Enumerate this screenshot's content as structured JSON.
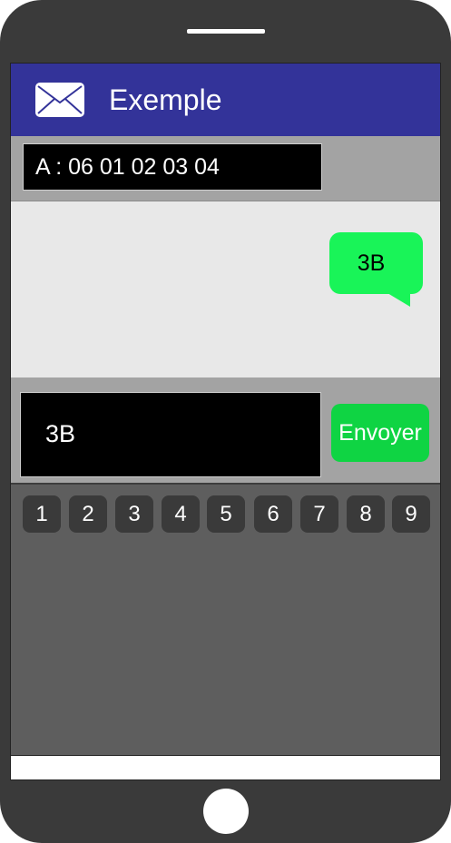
{
  "header": {
    "title": "Exemple",
    "icon": "envelope-icon"
  },
  "recipient": {
    "value": "A : 06 01 02 03 04"
  },
  "conversation": {
    "messages": [
      {
        "text": "3B"
      }
    ]
  },
  "compose": {
    "value": "3B",
    "send_label": "Envoyer"
  },
  "keypad": {
    "keys": [
      "1",
      "2",
      "3",
      "4",
      "5",
      "6",
      "7",
      "8",
      "9"
    ]
  },
  "colors": {
    "header": "#333399",
    "bubble": "#19f458",
    "send_button": "#0fd443",
    "phone_body": "#3a3a3a"
  }
}
